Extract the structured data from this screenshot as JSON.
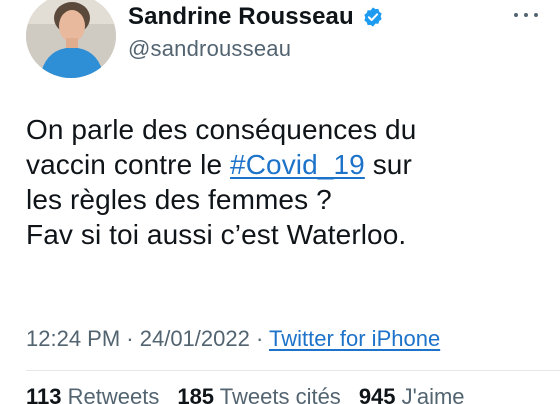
{
  "author": {
    "display_name": "Sandrine Rousseau",
    "handle": "@sandrousseau",
    "verified": true
  },
  "tweet": {
    "line1": "On parle des conséquences du",
    "line2_before": "vaccin contre le ",
    "hashtag": "#Covid_19",
    "line2_after": " sur",
    "line3": "les règles des femmes ?",
    "line4": "Fav si toi aussi c’est Waterloo."
  },
  "meta": {
    "time": "12:24 PM",
    "separator": " · ",
    "date": "24/01/2022",
    "source": "Twitter for iPhone"
  },
  "stats": {
    "retweets_count": "113",
    "retweets_label": " Retweets",
    "quotes_count": "185",
    "quotes_label": " Tweets cités",
    "likes_count": "945",
    "likes_label": " J'aime"
  },
  "icons": {
    "verified": "verified-badge-icon",
    "more": "more-options-icon"
  },
  "colors": {
    "link": "#1d73c9",
    "verified": "#1d9bf0",
    "secondary_text": "#536471",
    "primary_text": "#0f1419"
  }
}
